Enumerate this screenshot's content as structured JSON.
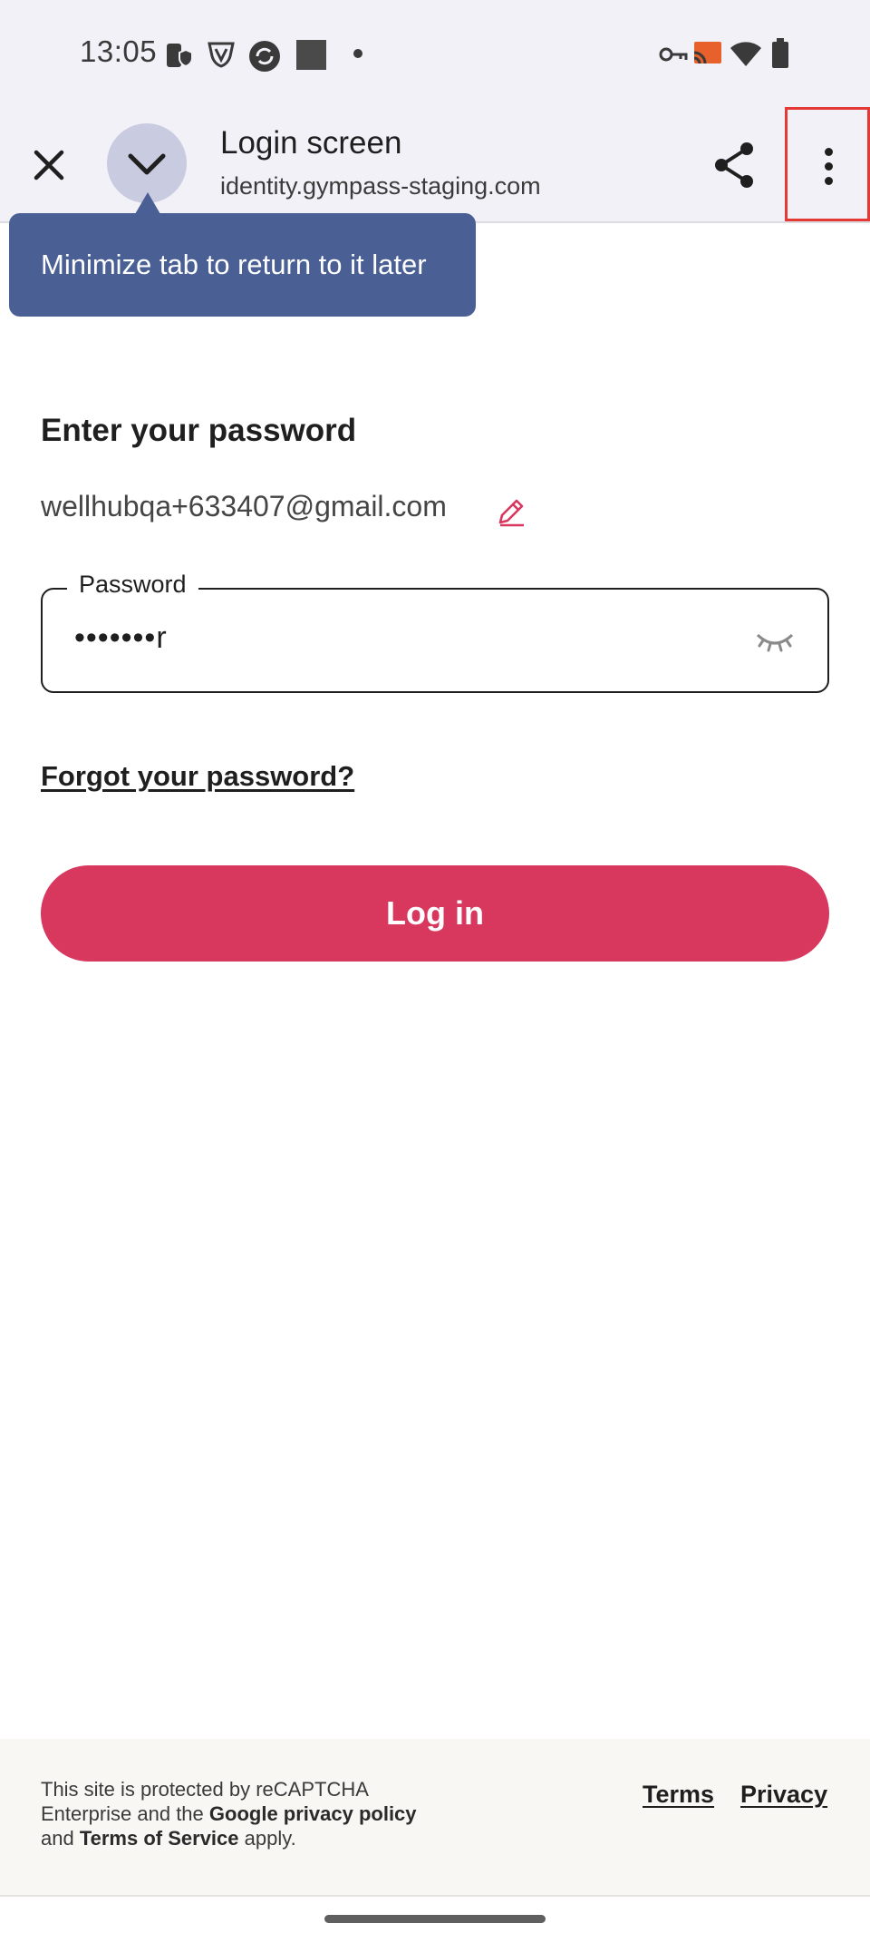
{
  "status_bar": {
    "time": "13:05",
    "left_icons": [
      "phone-shield-icon",
      "vpn-shield-icon",
      "sync-icon",
      "square-app-icon",
      "dot-icon"
    ],
    "right_icons": [
      "key-icon",
      "cast-icon",
      "wifi-icon",
      "battery-icon"
    ]
  },
  "toolbar": {
    "title": "Login screen",
    "url": "identity.gympass-staging.com"
  },
  "tooltip": {
    "text": "Minimize tab to return to it later"
  },
  "login": {
    "heading": "Enter your password",
    "email": "wellhubqa+633407@gmail.com",
    "password_label": "Password",
    "password_value": "•••••••r",
    "forgot_link": "Forgot your password?",
    "login_button": "Log in"
  },
  "footer": {
    "recaptcha_part1": "This site is protected by reCAPTCHA Enterprise and the ",
    "recaptcha_link1": "Google privacy policy",
    "recaptcha_part2": " and ",
    "recaptcha_link2": "Terms of Service",
    "recaptcha_part3": " apply.",
    "terms": "Terms",
    "privacy": "Privacy"
  },
  "colors": {
    "accent": "#d8375e",
    "tooltip_bg": "#4a5f94",
    "toolbar_bg": "#f2f1f7",
    "highlight_box": "#e53935"
  }
}
